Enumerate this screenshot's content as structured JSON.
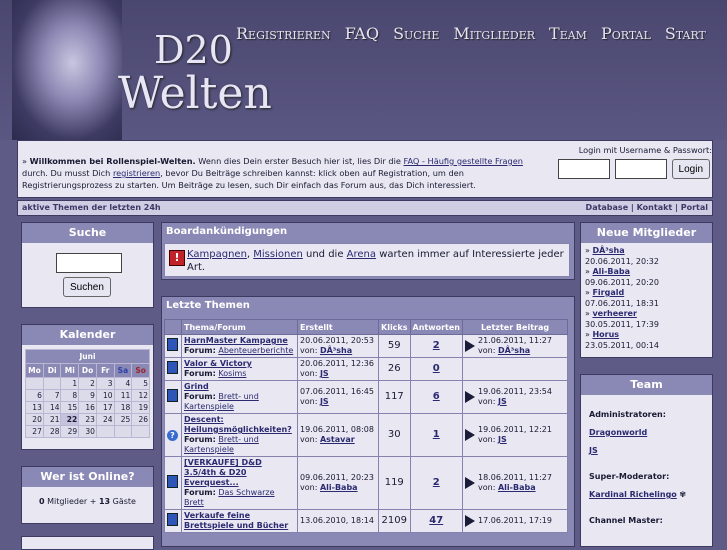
{
  "header": {
    "logo_line1": "D20",
    "logo_line2": "Welten",
    "nav": [
      "Registrieren",
      "FAQ",
      "Suche",
      "Mitglieder",
      "Team",
      "Portal",
      "Start"
    ]
  },
  "welcome": {
    "bullet": "» ",
    "bold": "Willkommen bei Rollenspiel-Welten.",
    "t1": " Wenn dies Dein erster Besuch hier ist, lies Dir die ",
    "faq_link": "FAQ - Häufig gestellte Fragen",
    "t2": " durch. Du musst Dich ",
    "reg_link": "registrieren",
    "t3": ", bevor Du Beiträge schreiben kannst: klick oben auf Registration, um den Registrierungsprozess zu starten. Um Beiträge zu lesen, such Dir einfach das Forum aus, das Dich interessiert."
  },
  "login": {
    "label": "Login mit Username & Passwort:",
    "button": "Login"
  },
  "bar": {
    "left": "aktive Themen der letzten 24h",
    "right": "Database | Kontakt | Portal"
  },
  "search": {
    "title": "Suche",
    "button": "Suchen"
  },
  "calendar": {
    "title": "Kalender",
    "month": "Juni",
    "days": [
      "Mo",
      "Di",
      "Mi",
      "Do",
      "Fr",
      "Sa",
      "So"
    ],
    "weeks": [
      [
        "",
        "",
        "1",
        "2",
        "3",
        "4",
        "5"
      ],
      [
        "6",
        "7",
        "8",
        "9",
        "10",
        "11",
        "12"
      ],
      [
        "13",
        "14",
        "15",
        "16",
        "17",
        "18",
        "19"
      ],
      [
        "20",
        "21",
        "22",
        "23",
        "24",
        "25",
        "26"
      ],
      [
        "27",
        "28",
        "29",
        "30",
        "",
        "",
        ""
      ]
    ]
  },
  "online": {
    "title": "Wer ist Online?",
    "count_members": "0",
    "label_members": "Mitglieder",
    "plus": " + ",
    "count_guests": "13",
    "label_guests": "Gäste"
  },
  "announcements": {
    "title": "Boardankündigungen",
    "link1": "Kampagnen",
    "sep1": ", ",
    "link2": "Missionen",
    "t1": " und die ",
    "link3": "Arena",
    "t2": " warten immer auf Interessierte jeder Art."
  },
  "topics": {
    "title": "Letzte Themen",
    "columns": [
      "Thema/Forum",
      "Erstellt",
      "Klicks",
      "Antworten",
      "Letzter Beitrag"
    ],
    "rows": [
      {
        "title": "HarnMaster Kampagne",
        "forum_label": "Forum:",
        "forum": "Abenteuerberichte",
        "created": "20.06.2011, 20:53",
        "by_label": "von:",
        "author": "DÂ³sha",
        "clicks": "59",
        "answers": "2",
        "last_date": "21.06.2011, 11:27",
        "last_by": "DÂ³sha",
        "has_last": true,
        "icon": "doc"
      },
      {
        "title": "Valor & Victory",
        "forum_label": "Forum:",
        "forum": "Kosims",
        "created": "20.06.2011, 12:36",
        "by_label": "von:",
        "author": "JS",
        "clicks": "26",
        "answers": "0",
        "last_date": "",
        "last_by": "",
        "has_last": false,
        "icon": "doc"
      },
      {
        "title": "Grind",
        "forum_label": "Forum:",
        "forum": "Brett- und Kartenspiele",
        "created": "07.06.2011, 16:45",
        "by_label": "von:",
        "author": "JS",
        "clicks": "117",
        "answers": "6",
        "last_date": "19.06.2011, 23:54",
        "last_by": "JS",
        "has_last": true,
        "icon": "doc"
      },
      {
        "title": "Descent: Heilungsmöglichkeiten?",
        "forum_label": "Forum:",
        "forum": "Brett- und Kartenspiele",
        "created": "19.06.2011, 08:08",
        "by_label": "von:",
        "author": "Astavar",
        "clicks": "30",
        "answers": "1",
        "last_date": "19.06.2011, 12:21",
        "last_by": "JS",
        "has_last": true,
        "icon": "question"
      },
      {
        "title": "[VERKAUFE] D&D 3.5/4th & D20 Everquest...",
        "forum_label": "Forum:",
        "forum": "Das Schwarze Brett",
        "created": "09.06.2011, 20:23",
        "by_label": "von:",
        "author": "Ali-Baba",
        "clicks": "119",
        "answers": "2",
        "last_date": "18.06.2011, 11:27",
        "last_by": "Ali-Baba",
        "has_last": true,
        "icon": "doc"
      },
      {
        "title": "Verkaufe feine Brettspiele und Bücher",
        "forum_label": "",
        "forum": "",
        "created": "13.06.2010, 18:14",
        "by_label": "",
        "author": "",
        "clicks": "2109",
        "answers": "47",
        "last_date": "17.06.2011, 17:19",
        "last_by": "",
        "has_last": true,
        "icon": "doc"
      }
    ]
  },
  "new_members": {
    "title": "Neue Mitglieder",
    "items": [
      {
        "name": "DÂ³sha",
        "date": "20.06.2011, 20:32"
      },
      {
        "name": "Ali-Baba",
        "date": "09.06.2011, 20:20"
      },
      {
        "name": "Firgald",
        "date": "07.06.2011, 18:31"
      },
      {
        "name": "verheerer",
        "date": "30.05.2011, 17:39"
      },
      {
        "name": "Horus",
        "date": "23.05.2011, 00:14"
      }
    ]
  },
  "team": {
    "title": "Team",
    "admins_label": "Administratoren:",
    "admins": [
      "Dragonworld",
      "JS"
    ],
    "supermod_label": "Super-Moderator:",
    "supermod": "Kardinal Richelingo",
    "channel_label": "Channel Master:"
  }
}
